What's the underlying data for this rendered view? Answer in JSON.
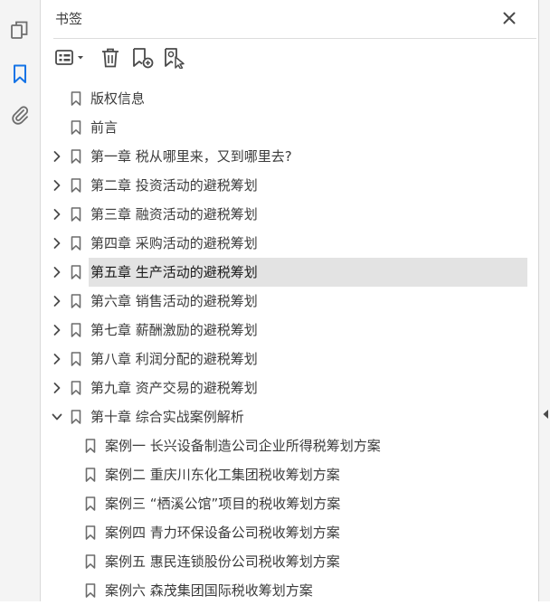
{
  "panel": {
    "title": "书签"
  },
  "icons": {
    "rail": [
      "pages-icon",
      "bookmark-icon",
      "attachment-icon"
    ],
    "toolbar": [
      "options-menu-icon",
      "delete-icon",
      "new-bookmark-icon",
      "new-bookmark-from-structure-icon"
    ],
    "close": "close-icon",
    "collapse": "collapse-panel-icon"
  },
  "colors": {
    "accent": "#1473e6",
    "icon": "#6d6d6d",
    "selected_bg": "#e3e3e3"
  },
  "bookmarks": [
    {
      "label": "版权信息",
      "level": 0,
      "expander": "none"
    },
    {
      "label": "前言",
      "level": 0,
      "expander": "none"
    },
    {
      "label": "第一章 税从哪里来，又到哪里去?",
      "level": 0,
      "expander": "collapsed"
    },
    {
      "label": "第二章 投资活动的避税筹划",
      "level": 0,
      "expander": "collapsed"
    },
    {
      "label": "第三章 融资活动的避税筹划",
      "level": 0,
      "expander": "collapsed"
    },
    {
      "label": "第四章 采购活动的避税筹划",
      "level": 0,
      "expander": "collapsed"
    },
    {
      "label": "第五章 生产活动的避税筹划",
      "level": 0,
      "expander": "collapsed",
      "selected": true
    },
    {
      "label": "第六章 销售活动的避税筹划",
      "level": 0,
      "expander": "collapsed"
    },
    {
      "label": "第七章 薪酬激励的避税筹划",
      "level": 0,
      "expander": "collapsed"
    },
    {
      "label": "第八章 利润分配的避税筹划",
      "level": 0,
      "expander": "collapsed"
    },
    {
      "label": "第九章 资产交易的避税筹划",
      "level": 0,
      "expander": "collapsed"
    },
    {
      "label": "第十章 综合实战案例解析",
      "level": 0,
      "expander": "expanded"
    },
    {
      "label": "案例一 长兴设备制造公司企业所得税筹划方案",
      "level": 1,
      "expander": "none"
    },
    {
      "label": "案例二 重庆川东化工集团税收筹划方案",
      "level": 1,
      "expander": "none"
    },
    {
      "label": "案例三 “栖溪公馆”项目的税收筹划方案",
      "level": 1,
      "expander": "none"
    },
    {
      "label": "案例四 青力环保设备公司税收筹划方案",
      "level": 1,
      "expander": "none"
    },
    {
      "label": "案例五 惠民连锁股份公司税收筹划方案",
      "level": 1,
      "expander": "none"
    },
    {
      "label": "案例六 森茂集团国际税收筹划方案",
      "level": 1,
      "expander": "none"
    }
  ]
}
